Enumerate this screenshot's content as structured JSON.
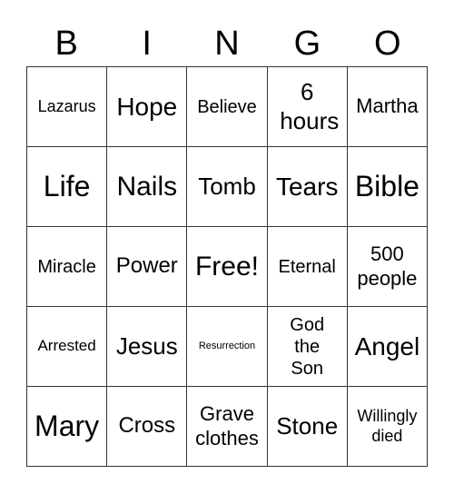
{
  "header": [
    "B",
    "I",
    "N",
    "G",
    "O"
  ],
  "cells": [
    [
      "Lazarus",
      "Hope",
      "Believe",
      "6 hours",
      "Martha"
    ],
    [
      "Life",
      "Nails",
      "Tomb",
      "Tears",
      "Bible"
    ],
    [
      "Miracle",
      "Power",
      "Free!",
      "Eternal",
      "500 people"
    ],
    [
      "Arrested",
      "Jesus",
      "Resurrection",
      "God the Son",
      "Angel"
    ],
    [
      "Mary",
      "Cross",
      "Grave clothes",
      "Stone",
      "Willingly died"
    ]
  ]
}
